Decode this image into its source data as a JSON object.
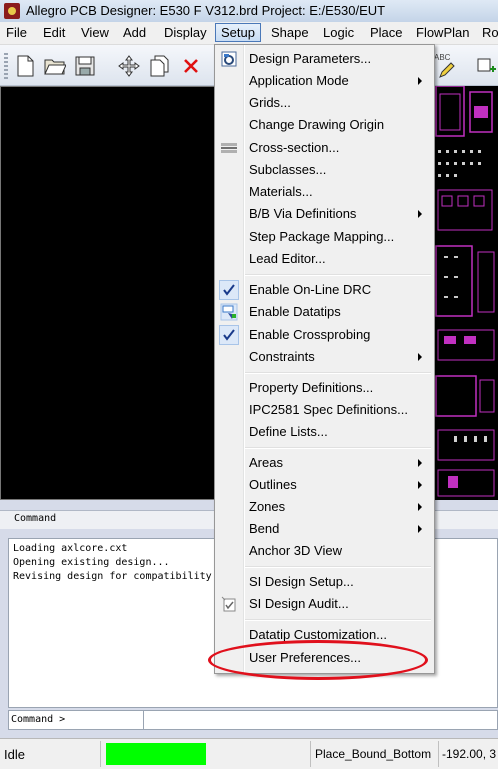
{
  "window": {
    "title": "Allegro PCB Designer: E530 F V312.brd  Project: E:/E530/EUT"
  },
  "menubar": [
    "File",
    "Edit",
    "View",
    "Add",
    "Display",
    "Setup",
    "Shape",
    "Logic",
    "Place",
    "FlowPlan",
    "Ro"
  ],
  "toolbar": {
    "abc_label": "ABC"
  },
  "setup_menu": {
    "items": [
      "Design Parameters...",
      "Application Mode",
      "Grids...",
      "Change Drawing Origin",
      "Cross-section...",
      "Subclasses...",
      "Materials...",
      "B/B Via Definitions",
      "Step Package Mapping...",
      "Lead Editor...",
      "Enable On-Line DRC",
      "Enable Datatips",
      "Enable Crossprobing",
      "Constraints",
      "Property Definitions...",
      "IPC2581 Spec Definitions...",
      "Define Lists...",
      "Areas",
      "Outlines",
      "Zones",
      "Bend",
      "Anchor 3D View",
      "SI Design Setup...",
      "SI Design Audit...",
      "Datatip Customization...",
      "User Preferences..."
    ]
  },
  "command_panel": {
    "header": "Command",
    "lines": [
      "Loading axlcore.cxt",
      "Opening existing design...",
      "Revising design for compatibility"
    ],
    "prompt": "Command >"
  },
  "status": {
    "state": "Idle",
    "subclass": "Place_Bound_Bottom",
    "coords": "-192.00, 3"
  },
  "colors": {
    "highlight_ellipse": "#e0101c",
    "status_green": "#00ff00",
    "pcb_magenta": "#c030c0"
  }
}
